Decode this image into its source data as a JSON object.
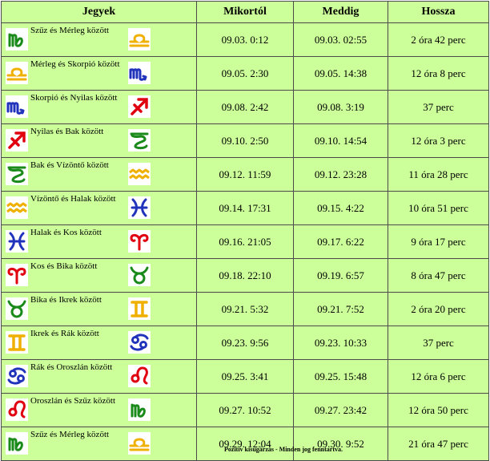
{
  "headers": {
    "signs": "Jegyek",
    "from": "Mikortól",
    "until": "Meddig",
    "duration": "Hossza"
  },
  "rows": [
    {
      "label": "Szűz és Mérleg között",
      "from": "09.03. 0:12",
      "until": "09.03. 02:55",
      "duration": "2  óra 42 perc",
      "sign_a": "virgo-icon",
      "sign_b": "libra-icon"
    },
    {
      "label": "Mérleg és Skorpió között",
      "from": "09.05. 2:30",
      "until": "09.05. 14:38",
      "duration": "12 óra 8 perc",
      "sign_a": "libra-icon",
      "sign_b": "scorpio-icon"
    },
    {
      "label": "Skorpió és Nyilas között",
      "from": "09.08. 2:42",
      "until": "09.08. 3:19",
      "duration": "37 perc",
      "sign_a": "scorpio-icon",
      "sign_b": "sagittarius-icon"
    },
    {
      "label": "Nyilas és Bak között",
      "from": "09.10. 2:50",
      "until": "09.10. 14:54",
      "duration": "12 óra 3 perc",
      "sign_a": "sagittarius-icon",
      "sign_b": "capricorn-icon"
    },
    {
      "label": "Bak és Vízöntő között",
      "from": "09.12. 11:59",
      "until": "09.12. 23:28",
      "duration": "11 óra 28 perc",
      "sign_a": "capricorn-icon",
      "sign_b": "aquarius-icon"
    },
    {
      "label": "Vízöntő és Halak között",
      "from": "09.14. 17:31",
      "until": "09.15. 4:22",
      "duration": "10 óra 51 perc",
      "sign_a": "aquarius-icon",
      "sign_b": "pisces-icon"
    },
    {
      "label": "Halak és Kos között",
      "from": "09.16. 21:05",
      "until": "09.17. 6:22",
      "duration": "9 óra 17 perc",
      "sign_a": "pisces-icon",
      "sign_b": "aries-icon"
    },
    {
      "label": "Kos és Bika között",
      "from": "09.18. 22:10",
      "until": "09.19. 6:57",
      "duration": "8 óra 47 perc",
      "sign_a": "aries-icon",
      "sign_b": "taurus-icon"
    },
    {
      "label": "Bika és Ikrek között",
      "from": "09.21. 5:32",
      "until": "09.21. 7:52",
      "duration": "2 óra 20 perc",
      "sign_a": "taurus-icon",
      "sign_b": "gemini-icon"
    },
    {
      "label": "Ikrek és Rák között",
      "from": "09.23. 9:56",
      "until": "09.23. 10:33",
      "duration": "37 perc",
      "sign_a": "gemini-icon",
      "sign_b": "cancer-icon"
    },
    {
      "label": "Rák és Oroszlán között",
      "from": "09.25. 3:41",
      "until": "09.25. 15:48",
      "duration": "12 óra 6 perc",
      "sign_a": "cancer-icon",
      "sign_b": "leo-icon"
    },
    {
      "label": "Oroszlán és Szűz között",
      "from": "09.27. 10:52",
      "until": "09.27. 23:42",
      "duration": "12 óra 50 perc",
      "sign_a": "leo-icon",
      "sign_b": "virgo-icon"
    },
    {
      "label": "Szűz és Mérleg között",
      "from": "09.29. 12:04",
      "until": "09.30. 9:52",
      "duration": "21 óra 47 perc",
      "sign_a": "virgo-icon",
      "sign_b": "libra-icon"
    }
  ],
  "footer": "Pozitív kisugárzás - Minden jog fenntartva.",
  "colors": {
    "cell_background": "#ccff99",
    "border": "#4b4b4b",
    "earth_sign": "#1a8a1a",
    "air_sign": "#f0b000",
    "water_sign": "#2233bb",
    "fire_sign": "#e00010"
  }
}
